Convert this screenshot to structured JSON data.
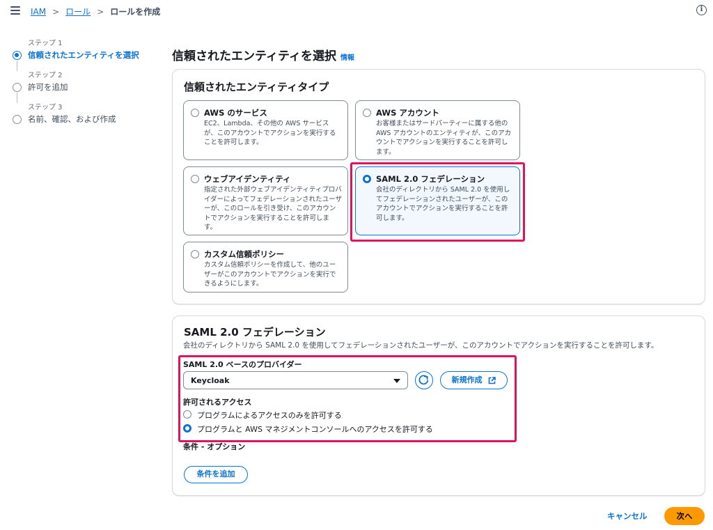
{
  "breadcrumb": {
    "items": [
      "IAM",
      "ロール"
    ],
    "current": "ロールを作成"
  },
  "steps": [
    {
      "num": "ステップ 1",
      "label": "信頼されたエンティティを選択",
      "active": true
    },
    {
      "num": "ステップ 2",
      "label": "許可を追加",
      "active": false
    },
    {
      "num": "ステップ 3",
      "label": "名前、確認、および作成",
      "active": false
    }
  ],
  "page": {
    "title": "信頼されたエンティティを選択",
    "info": "情報"
  },
  "entity_type": {
    "title": "信頼されたエンティティタイプ",
    "selected": "saml",
    "tiles": {
      "aws_service": {
        "title": "AWS のサービス",
        "desc": "EC2、Lambda、その他の AWS サービスが、このアカウントでアクションを実行することを許可します。"
      },
      "aws_account": {
        "title": "AWS アカウント",
        "desc": "お客様またはサードパーティーに属する他の AWS アカウントのエンティティが、このアカウントでアクションを実行することを許可します。"
      },
      "web_identity": {
        "title": "ウェブアイデンティティ",
        "desc": "指定された外部ウェブアイデンティティプロバイダーによってフェデレーションされたユーザーが、このロールを引き受け、このアカウントでアクションを実行することを許可します。"
      },
      "saml": {
        "title": "SAML 2.0 フェデレーション",
        "desc": "会社のディレクトリから SAML 2.0 を使用してフェデレーションされたユーザーが、このアカウントでアクションを実行することを許可します。"
      },
      "custom": {
        "title": "カスタム信頼ポリシー",
        "desc": "カスタム信頼ポリシーを作成して、他のユーザーがこのアカウントでアクションを実行できるようにします。"
      }
    }
  },
  "saml_section": {
    "title": "SAML 2.0 フェデレーション",
    "desc": "会社のディレクトリから SAML 2.0 を使用してフェデレーションされたユーザーが、このアカウントでアクションを実行することを許可します。",
    "provider_label": "SAML 2.0 ベースのプロバイダー",
    "provider_value": "Keycloak",
    "new_button": "新規作成",
    "access_label": "許可されるアクセス",
    "access_options": [
      {
        "label": "プログラムによるアクセスのみを許可する",
        "checked": false
      },
      {
        "label": "プログラムと AWS マネジメントコンソールへのアクセスを許可する",
        "checked": true
      }
    ],
    "conditions_label": "条件 - オプション",
    "add_condition": "条件を追加"
  },
  "footer": {
    "cancel": "キャンセル",
    "next": "次へ"
  },
  "colors": {
    "accent": "#0972d3",
    "highlight": "#e0115f",
    "primary_button": "#ff9900"
  }
}
